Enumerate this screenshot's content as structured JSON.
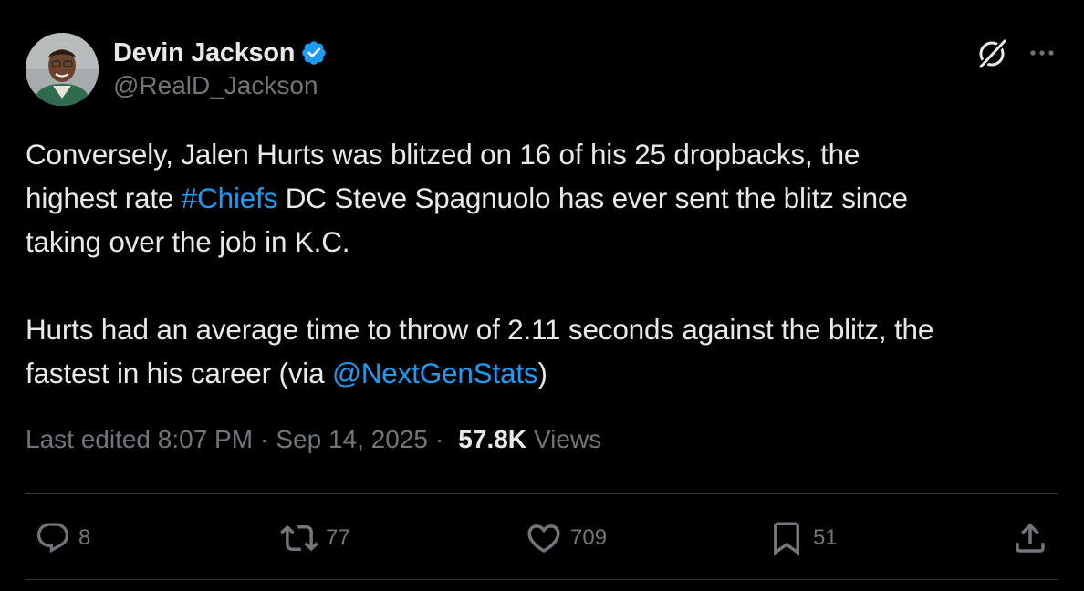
{
  "author": {
    "display_name": "Devin Jackson",
    "handle": "@RealD_Jackson",
    "verified": true
  },
  "tweet": {
    "line1": "Conversely, Jalen Hurts was blitzed on 16 of his 25 dropbacks, the",
    "line2_a": "highest rate ",
    "hashtag": "#Chiefs",
    "line2_b": " DC Steve Spagnuolo has ever sent the blitz since",
    "line3": "taking over the job in K.C.",
    "line4": "Hurts had an average time to throw of 2.11 seconds against the blitz, the",
    "line5_a": "fastest in his career (via ",
    "mention": "@NextGenStats",
    "line5_b": ")"
  },
  "meta": {
    "edited": "Last edited 8:07 PM",
    "sep1": "·",
    "date": "Sep 14, 2025",
    "sep2": "·",
    "views_count": "57.8K",
    "views_label": "Views"
  },
  "actions": {
    "replies": "8",
    "reposts": "77",
    "likes": "709",
    "bookmarks": "51"
  },
  "icons": [
    "verified-badge-icon",
    "grok-icon",
    "more-icon",
    "reply-icon",
    "repost-icon",
    "like-icon",
    "bookmark-icon",
    "share-icon"
  ],
  "colors": {
    "background": "#000000",
    "text": "#e7e9ea",
    "secondary": "#71767b",
    "link": "#1d9bf0",
    "divider": "#2f3336"
  }
}
